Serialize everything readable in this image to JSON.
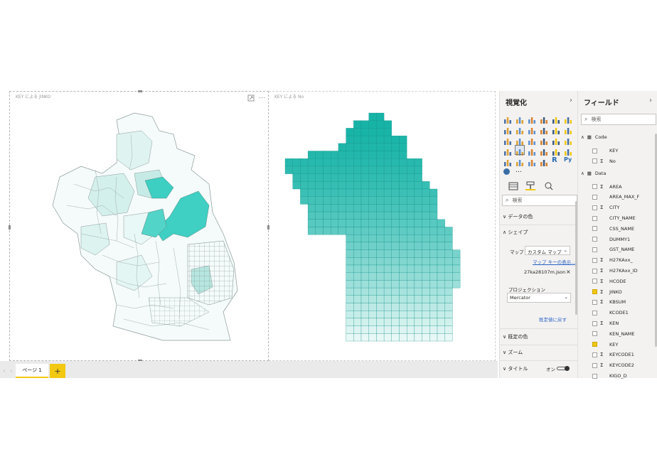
{
  "report": {
    "left_visual_title": "KEY による JINKO",
    "right_visual_title": "KEY による No",
    "more_options": "…"
  },
  "tabs": [
    {
      "label": "ページ 1"
    },
    {
      "label": "+"
    }
  ],
  "viz_pane": {
    "title": "視覚化",
    "chevron": "›",
    "more": "…",
    "search_placeholder": "検索",
    "sections": {
      "data_colors": "データの色",
      "shape": "シェイプ",
      "map_label": "マップ",
      "map_value": "カスタム マップ",
      "map_keys_link": "マップ キーの表示...",
      "file_name": "27ka28107m.json",
      "projection_label": "プロジェクション",
      "projection_value": "Mercator",
      "reset_default": "既定値に戻す",
      "default_color": "既定の色",
      "zoom": "ズーム",
      "title_section": "タイトル",
      "title_toggle": "オン"
    },
    "icon_letters": {
      "r": "R",
      "py": "Py"
    }
  },
  "fields_pane": {
    "title": "フィールド",
    "chevron": "›",
    "search_placeholder": "検索",
    "tables": [
      {
        "name": "Code",
        "fields": [
          {
            "name": "KEY",
            "sigma": false,
            "checked": false
          },
          {
            "name": "No",
            "sigma": true,
            "checked": false
          }
        ]
      },
      {
        "name": "Data",
        "fields": [
          {
            "name": "AREA",
            "sigma": true,
            "checked": false
          },
          {
            "name": "AREA_MAX_F",
            "sigma": false,
            "checked": false
          },
          {
            "name": "CITY",
            "sigma": true,
            "checked": false
          },
          {
            "name": "CITY_NAME",
            "sigma": false,
            "checked": false
          },
          {
            "name": "CSS_NAME",
            "sigma": false,
            "checked": false
          },
          {
            "name": "DUMMY1",
            "sigma": false,
            "checked": false
          },
          {
            "name": "GST_NAME",
            "sigma": false,
            "checked": false
          },
          {
            "name": "H27KAxx_",
            "sigma": true,
            "checked": false
          },
          {
            "name": "H27KAxx_ID",
            "sigma": true,
            "checked": false
          },
          {
            "name": "HCODE",
            "sigma": true,
            "checked": false
          },
          {
            "name": "JINKO",
            "sigma": true,
            "checked": true
          },
          {
            "name": "KBSUM",
            "sigma": true,
            "checked": false
          },
          {
            "name": "KCODE1",
            "sigma": false,
            "checked": false
          },
          {
            "name": "KEN",
            "sigma": true,
            "checked": false
          },
          {
            "name": "KEN_NAME",
            "sigma": false,
            "checked": false
          },
          {
            "name": "KEY",
            "sigma": false,
            "checked": true
          },
          {
            "name": "KEYCODE1",
            "sigma": true,
            "checked": false
          },
          {
            "name": "KEYCODE2",
            "sigma": true,
            "checked": false
          },
          {
            "name": "KIGO_D",
            "sigma": false,
            "checked": false
          }
        ]
      }
    ]
  },
  "colors": {
    "teal_dark": "#16b3a7",
    "teal_light": "#e6f7f5",
    "accent_yellow": "#f2c811"
  }
}
